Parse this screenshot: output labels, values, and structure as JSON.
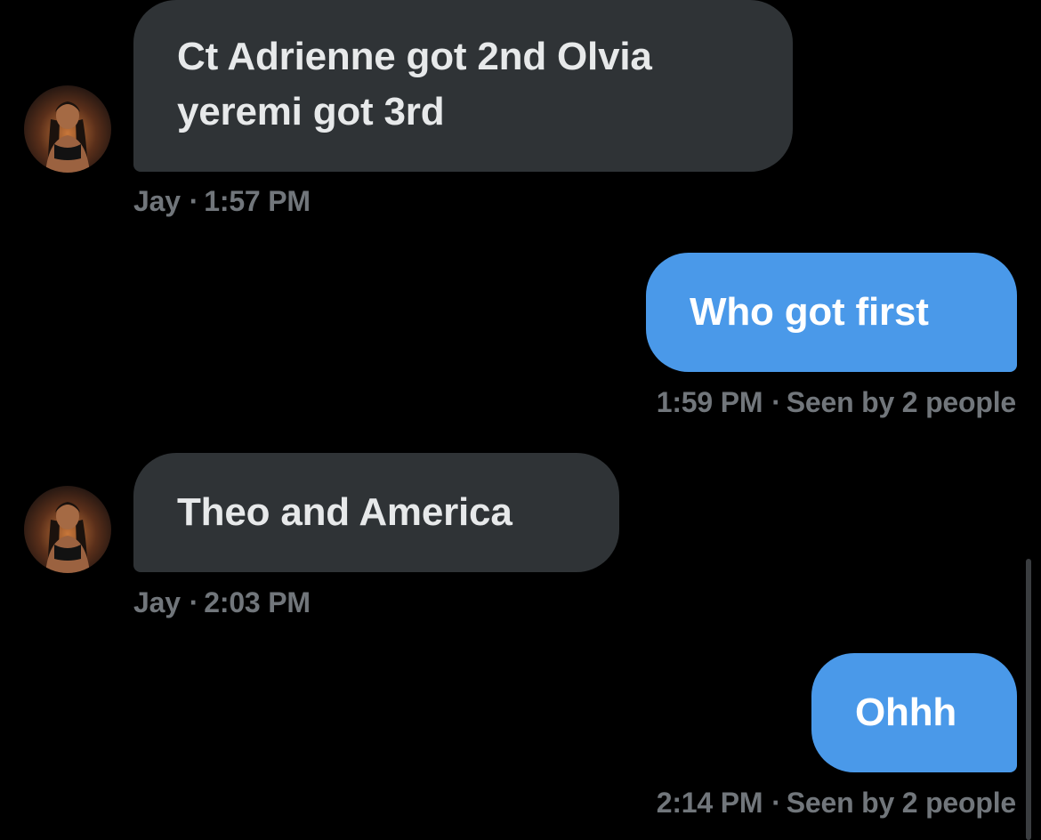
{
  "messages": [
    {
      "direction": "incoming",
      "sender": "Jay",
      "lines": [
        "Ct Adrienne got 2nd Olvia",
        "yeremi got 3rd"
      ],
      "time": "1:57 PM"
    },
    {
      "direction": "outgoing",
      "lines": [
        "Who got first"
      ],
      "time": "1:59 PM",
      "status": "Seen by 2 people"
    },
    {
      "direction": "incoming",
      "sender": "Jay",
      "lines": [
        "Theo and America"
      ],
      "time": "2:03 PM"
    },
    {
      "direction": "outgoing",
      "lines": [
        "Ohhh"
      ],
      "time": "2:14 PM",
      "status": "Seen by 2 people"
    }
  ],
  "separator": "·",
  "colors": {
    "background": "#000000",
    "incoming_bubble": "#2f3336",
    "outgoing_bubble": "#4a99e9",
    "meta_text": "#71767b"
  },
  "icons": {
    "avatar": "profile-photo-avatar"
  }
}
